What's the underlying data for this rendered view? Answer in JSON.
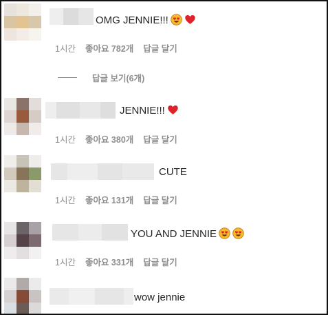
{
  "comments": [
    {
      "text": "OMG JENNIE!!!",
      "emoji": [
        "heart-eyes",
        "red-heart"
      ],
      "time": "1시간",
      "likes": "좋아요 782개",
      "reply": "답글 달기"
    },
    {
      "text": "JENNIE!!!",
      "emoji": [
        "red-heart"
      ],
      "time": "1시간",
      "likes": "좋아요 380개",
      "reply": "답글 달기"
    },
    {
      "text": "CUTE",
      "emoji": [],
      "time": "1시간",
      "likes": "좋아요 131개",
      "reply": "답글 달기"
    },
    {
      "text": "YOU AND JENNIE",
      "emoji": [
        "heart-eyes",
        "heart-eyes"
      ],
      "time": "1시간",
      "likes": "좋아요 331개",
      "reply": "답글 달기"
    },
    {
      "text": "wow jennie",
      "emoji": []
    }
  ],
  "view_replies": "답글 보기(6개)"
}
